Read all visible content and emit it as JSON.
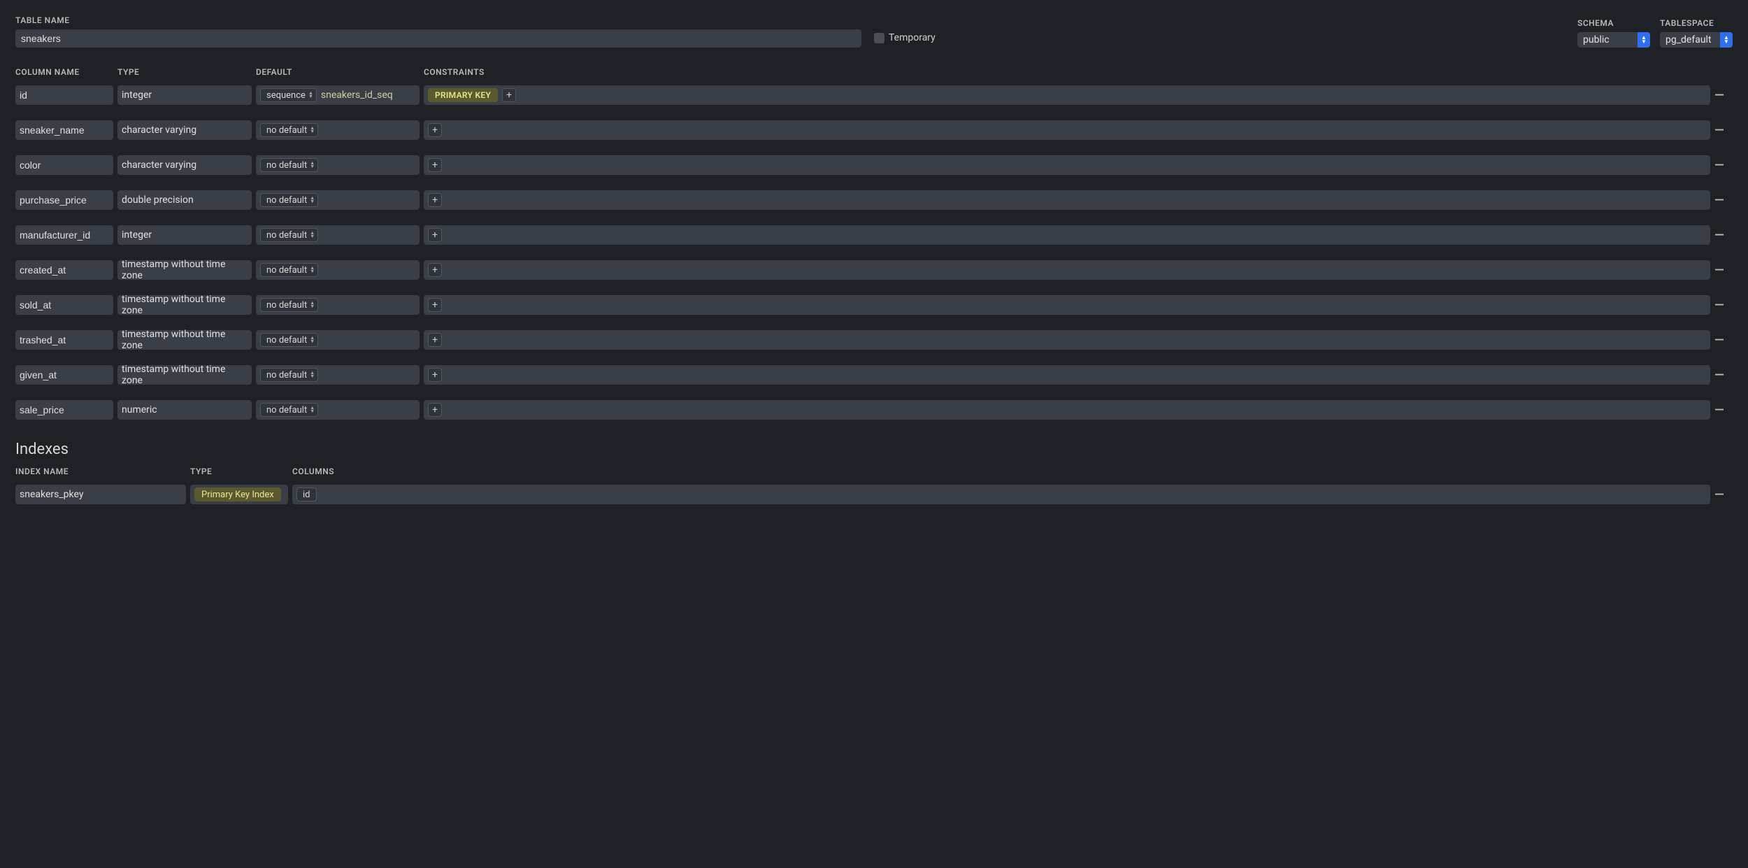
{
  "header": {
    "table_name_label": "TABLE NAME",
    "schema_label": "SCHEMA",
    "tablespace_label": "TABLESPACE",
    "temporary_label": "Temporary",
    "table_name_value": "sneakers",
    "schema_value": "public",
    "tablespace_value": "pg_default"
  },
  "cols_header": {
    "name": "COLUMN NAME",
    "type": "TYPE",
    "default": "DEFAULT",
    "constraints": "CONSTRAINTS"
  },
  "default_labels": {
    "sequence": "sequence",
    "no_default": "no default"
  },
  "sequence_name": "sneakers_id_seq",
  "pk_badge": "PRIMARY KEY",
  "columns": [
    {
      "name": "id",
      "type": "integer",
      "default_kind": "sequence"
    },
    {
      "name": "sneaker_name",
      "type": "character varying",
      "default_kind": "no_default"
    },
    {
      "name": "color",
      "type": "character varying",
      "default_kind": "no_default"
    },
    {
      "name": "purchase_price",
      "type": "double precision",
      "default_kind": "no_default"
    },
    {
      "name": "manufacturer_id",
      "type": "integer",
      "default_kind": "no_default"
    },
    {
      "name": "created_at",
      "type": "timestamp without time zone",
      "default_kind": "no_default"
    },
    {
      "name": "sold_at",
      "type": "timestamp without time zone",
      "default_kind": "no_default"
    },
    {
      "name": "trashed_at",
      "type": "timestamp without time zone",
      "default_kind": "no_default"
    },
    {
      "name": "given_at",
      "type": "timestamp without time zone",
      "default_kind": "no_default"
    },
    {
      "name": "sale_price",
      "type": "numeric",
      "default_kind": "no_default"
    }
  ],
  "indexes": {
    "title": "Indexes",
    "header": {
      "name": "INDEX NAME",
      "type": "TYPE",
      "columns": "COLUMNS"
    },
    "rows": [
      {
        "name": "sneakers_pkey",
        "type_badge": "Primary Key Index",
        "cols": [
          "id"
        ]
      }
    ]
  }
}
